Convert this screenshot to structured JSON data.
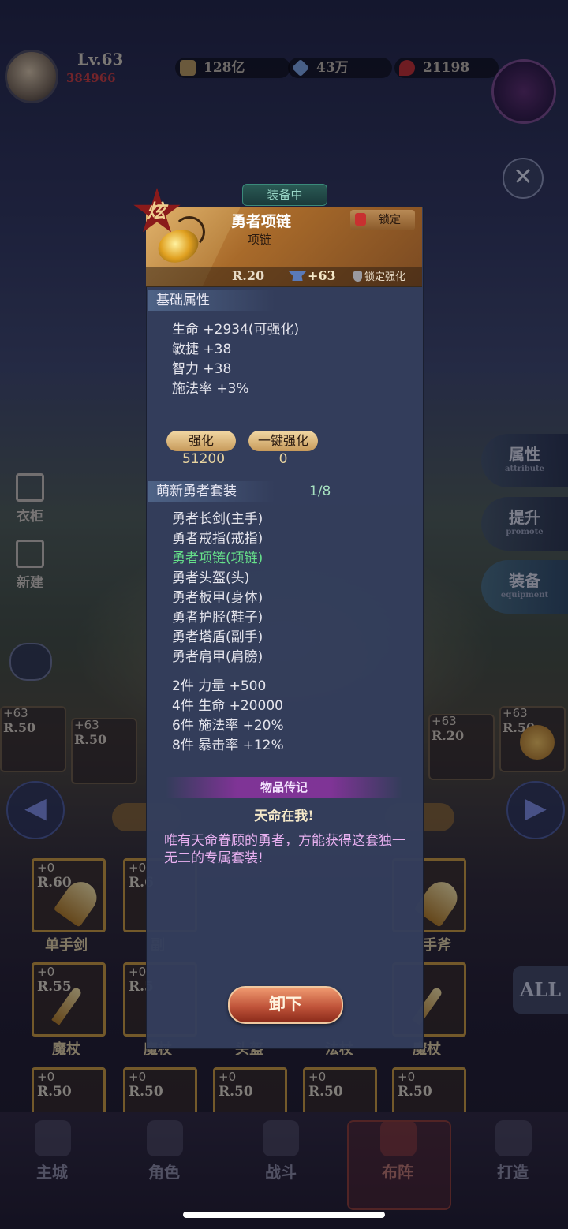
{
  "player": {
    "level": "Lv.63",
    "power": "384966"
  },
  "resources": [
    {
      "icon": "gold-coin-icon",
      "value": "128亿"
    },
    {
      "icon": "diamond-icon",
      "value": "43万"
    },
    {
      "icon": "ruby-icon",
      "value": "21198"
    }
  ],
  "left_panel": {
    "wardrobe": "衣柜",
    "new": "新建"
  },
  "right_tabs": [
    {
      "label": "属性",
      "sub": "attribute"
    },
    {
      "label": "提升",
      "sub": "promote"
    },
    {
      "label": "装备",
      "sub": "equipment"
    }
  ],
  "equip_strip": [
    {
      "plus": "+63",
      "rank": "R.50"
    },
    {
      "plus": "+63",
      "rank": "R.50"
    },
    {
      "plus": "+63",
      "rank": "R.20"
    },
    {
      "plus": "+63",
      "rank": "R.50"
    }
  ],
  "inventory": {
    "row1": [
      {
        "plus": "+0",
        "rank": "R.60",
        "label": "单手剑"
      },
      {
        "plus": "+0",
        "rank": "R.6",
        "label": "副"
      },
      {
        "plus": "",
        "rank": "",
        "label": ""
      },
      {
        "plus": "",
        "rank": "",
        "label": ""
      },
      {
        "plus": "",
        "rank": "",
        "label": "手斧"
      }
    ],
    "row2": [
      {
        "plus": "+0",
        "rank": "R.55",
        "label": "魔杖"
      },
      {
        "plus": "+0",
        "rank": "R.5",
        "label": "魔杖"
      },
      {
        "plus": "",
        "rank": "",
        "label": "头盔"
      },
      {
        "plus": "",
        "rank": "",
        "label": "法杖"
      },
      {
        "plus": "",
        "rank": "",
        "label": "魔杖"
      }
    ],
    "row3": [
      {
        "plus": "+0",
        "rank": "R.50"
      },
      {
        "plus": "+0",
        "rank": "R.50"
      },
      {
        "plus": "+0",
        "rank": "R.50"
      },
      {
        "plus": "+0",
        "rank": "R.50"
      },
      {
        "plus": "+0",
        "rank": "R.50"
      }
    ],
    "all_label": "ALL"
  },
  "nav": [
    {
      "label": "主城",
      "icon": "castle-icon"
    },
    {
      "label": "角色",
      "icon": "helmet-icon"
    },
    {
      "label": "战斗",
      "icon": "crossed-swords-icon"
    },
    {
      "label": "布阵",
      "icon": "formation-icon"
    },
    {
      "label": "打造",
      "icon": "anvil-icon"
    }
  ],
  "item": {
    "equipped_tag": "装备中",
    "badge": "炫",
    "name": "勇者项链",
    "type": "项链",
    "lock_label": "锁定",
    "rank": "R.20",
    "enhance": "+63",
    "lock_enhance": "锁定强化",
    "base_header": "基础属性",
    "base_stats": [
      "生命 +2934(可强化)",
      "敏捷 +38",
      "智力 +38",
      "施法率 +3%"
    ],
    "enhance_btn": "强化",
    "enhance_cost": "51200",
    "oneclick_btn": "一键强化",
    "oneclick_cost": "0",
    "set_name": "萌新勇者套装",
    "set_count": "1/8",
    "set_pieces": [
      {
        "name": "勇者长剑(主手)",
        "owned": false
      },
      {
        "name": "勇者戒指(戒指)",
        "owned": false
      },
      {
        "name": "勇者项链(项链)",
        "owned": true
      },
      {
        "name": "勇者头盔(头)",
        "owned": false
      },
      {
        "name": "勇者板甲(身体)",
        "owned": false
      },
      {
        "name": "勇者护胫(鞋子)",
        "owned": false
      },
      {
        "name": "勇者塔盾(副手)",
        "owned": false
      },
      {
        "name": "勇者肩甲(肩膀)",
        "owned": false
      }
    ],
    "set_bonuses": [
      "2件 力量 +500",
      "4件 生命 +20000",
      "6件 施法率 +20%",
      "8件 暴击率 +12%"
    ],
    "bio_title": "物品传记",
    "bio_heading": "天命在我!",
    "bio_text": "唯有天命眷顾的勇者，方能获得这套独一无二的专属套装!",
    "unequip_btn": "卸下"
  },
  "colors": {
    "set_owned": "#66e08a",
    "bio_text": "#e8b0f0",
    "popup_bg": "#343e5c",
    "header_gold": "#a86a2a"
  }
}
